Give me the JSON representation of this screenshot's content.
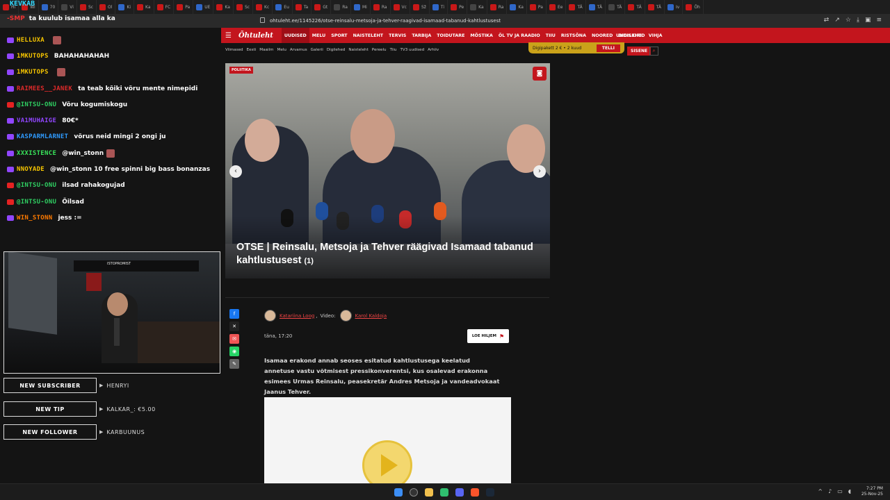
{
  "browser": {
    "tabs": [
      "Hi",
      "Wi",
      "70",
      "Vi",
      "Sc",
      "Ol",
      "Ki",
      "Ka",
      "FC",
      "Pa",
      "UE",
      "Ka",
      "Sc",
      "Kc",
      "Eu",
      "Ta",
      "Gt",
      "Ra",
      "Mi",
      "Ra",
      "Vc",
      "Sž",
      "Ti",
      "Pe",
      "Ka",
      "Ra",
      "Ka",
      "Pa",
      "Ee",
      "TÄ",
      "TÄ",
      "TÄ",
      "TÄ",
      "TÄ",
      "Iv",
      "Õh"
    ],
    "url": "ohtuleht.ee/1145226/otse-reinsalu-metsoja-ja-tehver-raagivad-isamaad-tabanud-kahtlustusest"
  },
  "stream": {
    "top_name": "KEVKAB",
    "title_prefix": "-SMP",
    "title": "ta kuulub isamaa alla ka"
  },
  "chat": [
    {
      "user": "HELLUXA",
      "msg": "",
      "platform": "tw",
      "color": "#f5c400",
      "emote": true
    },
    {
      "user": "1MKUTOPS",
      "msg": "BAHAHAHAHAH",
      "platform": "tw",
      "color": "#f5c400",
      "emote": false
    },
    {
      "user": "1MKUTOPS",
      "msg": "",
      "platform": "tw",
      "color": "#f5c400",
      "emote": true
    },
    {
      "user": "RAIMEES__JANEK",
      "msg": "ta teab kõiki võru mente nimepidi",
      "platform": "tw",
      "color": "#e02a2a",
      "emote": false
    },
    {
      "user": "@INTSU-ONU",
      "msg": "Võru kogumiskogu",
      "platform": "yt",
      "color": "#2fcf62",
      "emote": false
    },
    {
      "user": "VA1MUHAIGE",
      "msg": "80€*",
      "platform": "tw",
      "color": "#9146ff",
      "emote": false
    },
    {
      "user": "KASPARMLARNET",
      "msg": "võrus neid mingi 2 ongi ju",
      "platform": "tw",
      "color": "#2f9bff",
      "emote": false
    },
    {
      "user": "XXXISTENCE",
      "msg": "@win_stonn",
      "platform": "tw",
      "color": "#39e55b",
      "emote": true
    },
    {
      "user": "NNOYADE",
      "msg": "@win_stonn 10 free spinni big bass bonanzas",
      "platform": "tw",
      "color": "#f5c400",
      "emote": false
    },
    {
      "user": "@INTSU-ONU",
      "msg": "ilsad rahakogujad",
      "platform": "yt",
      "color": "#2fcf62",
      "emote": false
    },
    {
      "user": "@INTSU-ONU",
      "msg": "Õilsad",
      "platform": "yt",
      "color": "#2fcf62",
      "emote": false
    },
    {
      "user": "WIN_STONN",
      "msg": "jess :=",
      "platform": "tw",
      "color": "#ff7a00",
      "emote": false
    }
  ],
  "cam": {
    "sign": "ISTOPROMIST"
  },
  "alerts": [
    {
      "label": "NEW SUBSCRIBER",
      "value": "HENRYI"
    },
    {
      "label": "NEW TIP",
      "value": "KALKAR_: €5.00"
    },
    {
      "label": "NEW FOLLOWER",
      "value": "KARBUUNUS"
    }
  ],
  "site": {
    "logo": "Õhtuleht",
    "nav": [
      "UUDISED",
      "MELU",
      "SPORT",
      "NAISTELEHT",
      "TERVIS",
      "TARBIJA",
      "TOIDUTARE",
      "MÕSTIKA",
      "ÕL TV JA RAADIO",
      "TIIU",
      "RISTSÕNA",
      "NOORED",
      "DIGILEHED"
    ],
    "nav_right": [
      "UUDISKIRI",
      "VIHJA"
    ],
    "subnav": [
      "Viimased",
      "Eesti",
      "Maailm",
      "Melu",
      "Arvamus",
      "Galerii",
      "Digilehed",
      "Naisteleht",
      "Pereelu",
      "Tiiu",
      "TV3 uudised",
      "Arhiiv"
    ],
    "promo": "Digipakett 2 € • 2 kuud",
    "promo_btn": "TELLI",
    "login": "SISENE",
    "category": "POLIITIKA",
    "headline": "OTSE | Reinsalu, Metsoja ja Tehver räägivad Isamaad tabanud kahtlustusest",
    "photo_count": "(1)",
    "author1": "Katariina Loog",
    "video_label": "Video:",
    "author2": "Karol Kaldoja",
    "date": "täna, 17:20",
    "read_later": "LOE HILJEM",
    "lead": "Isamaa erakond annab seoses esitatud kahtlustusega keelatud annetuse vastu võtmisest pressikonverentsi, kus osalevad erakonna esimees Urmas Reinsalu, peasekretär Andres Metsoja ja vandeadvokaat Jaanus Tehver."
  },
  "taskbar": {
    "time": "7:27 PM",
    "date": "25-Nov-25"
  }
}
